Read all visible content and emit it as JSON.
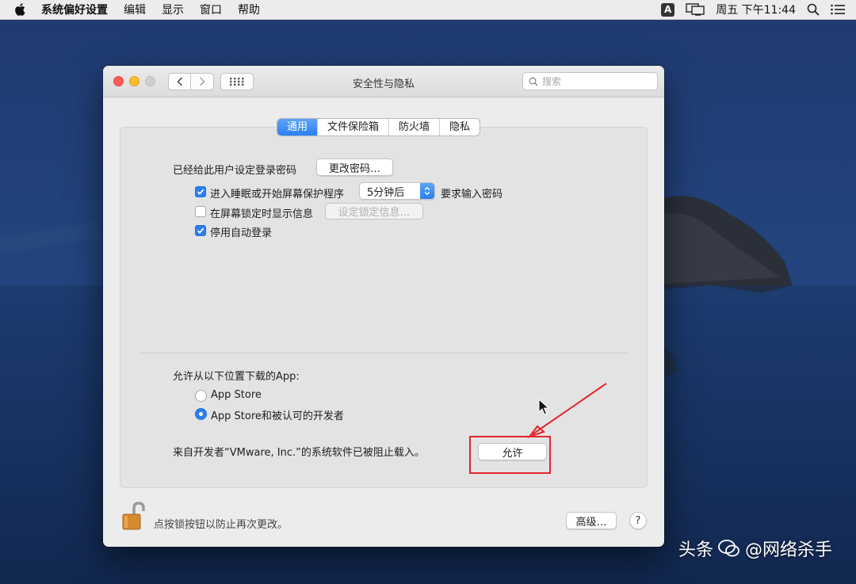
{
  "menubar": {
    "app_name": "系统偏好设置",
    "menus": [
      "编辑",
      "显示",
      "窗口",
      "帮助"
    ],
    "input_method": "A",
    "clock": "周五 下午11:44"
  },
  "window": {
    "title": "安全性与隐私",
    "search_placeholder": "搜索"
  },
  "tabs": [
    {
      "label": "通用",
      "active": true
    },
    {
      "label": "文件保险箱",
      "active": false
    },
    {
      "label": "防火墙",
      "active": false
    },
    {
      "label": "隐私",
      "active": false
    }
  ],
  "general": {
    "password_label": "已经给此用户设定登录密码",
    "change_password_button": "更改密码…",
    "require_password": {
      "checked": true,
      "label": "进入睡眠或开始屏幕保护程序",
      "select_value": "5分钟后",
      "suffix": "要求输入密码"
    },
    "show_message": {
      "checked": false,
      "label": "在屏幕锁定时显示信息",
      "button": "设定锁定信息…"
    },
    "disable_autologin": {
      "checked": true,
      "label": "停用自动登录"
    }
  },
  "downloads": {
    "heading": "允许从以下位置下载的App:",
    "options": [
      {
        "label": "App Store",
        "selected": false
      },
      {
        "label": "App Store和被认可的开发者",
        "selected": true
      }
    ],
    "blocked_message": "来自开发者“VMware, Inc.”的系统软件已被阻止载入。",
    "allow_button": "允许"
  },
  "footer": {
    "lock_message": "点按锁按钮以防止再次更改。",
    "advanced_button": "高级…",
    "help_button": "?"
  },
  "watermark": {
    "prefix": "头条",
    "handle": "@网络杀手"
  },
  "colors": {
    "accent": "#2c7ff1",
    "highlight": "#e3262c"
  }
}
